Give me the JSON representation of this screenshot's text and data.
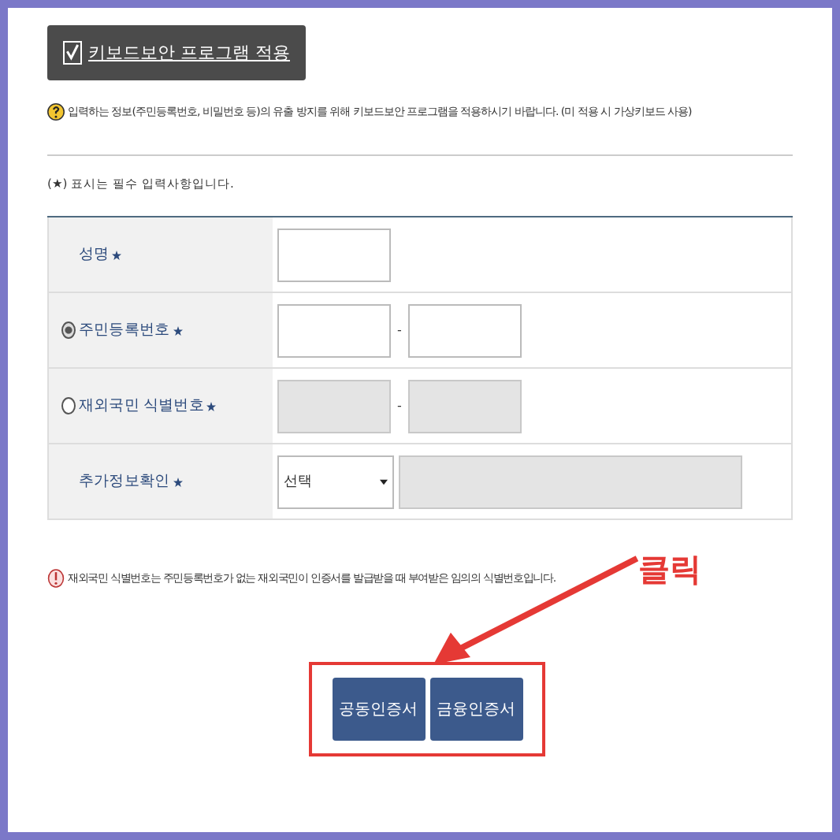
{
  "keyboard_security": {
    "label": "키보드보안 프로그램 적용",
    "checked": true
  },
  "info_note": "입력하는 정보(주민등록번호, 비밀번호 등)의 유출 방지를 위해 키보드보안 프로그램을 적용하시기 바랍니다. (미 적용 시 가상키보드 사용)",
  "required_note": "(★) 표시는 필수 입력사항입니다.",
  "form_rows": [
    {
      "kind": "single",
      "label": "성명",
      "required": true
    },
    {
      "kind": "pair",
      "label": "주민등록번호",
      "required": true,
      "selected": true,
      "disabled": false,
      "separator": "-"
    },
    {
      "kind": "pair",
      "label": "재외국민 식별번호",
      "required": true,
      "selected": false,
      "disabled": true,
      "separator": "-"
    },
    {
      "kind": "select",
      "label": "추가정보확인",
      "required": true,
      "select_value": "선택",
      "disabled": true
    }
  ],
  "warning_note": "재외국민 식별번호는 주민등록번호가 없는 재외국민이 인증서를 발급받을 때 부여받은 임의의 식별번호입니다.",
  "annotation": "클릭",
  "buttons": [
    "공동인증서",
    "금융인증서"
  ]
}
